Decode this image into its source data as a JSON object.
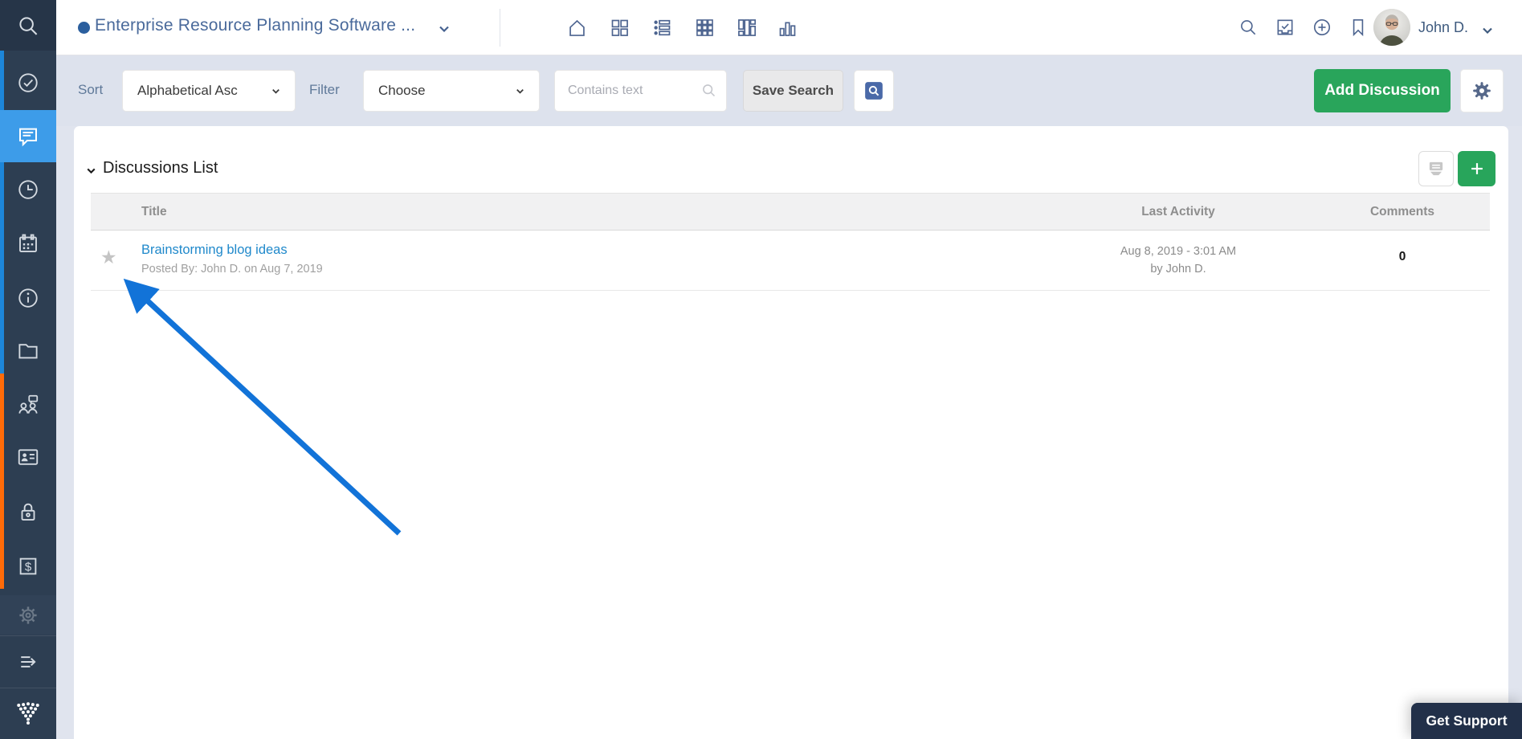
{
  "topbar": {
    "title": "Enterprise Resource Planning Software ...",
    "user_name": "John D.",
    "nav_icons": [
      "home-icon",
      "grid-2x2-icon",
      "list-view-icon",
      "grid-3x3-icon",
      "board-columns-icon",
      "bar-chart-icon"
    ],
    "right_icons": [
      "search-icon",
      "task-check-icon",
      "plus-circle-icon",
      "bookmark-icon",
      "bell-icon"
    ]
  },
  "sidebar": {
    "items": [
      "search",
      "tasks",
      "discussions",
      "time",
      "calendar",
      "info",
      "files",
      "workload",
      "contacts",
      "permissions",
      "expenses",
      "settings",
      "collapse",
      "logo"
    ],
    "active_item": "discussions"
  },
  "filter_bar": {
    "sort_label": "Sort",
    "sort_value": "Alphabetical Asc",
    "filter_label": "Filter",
    "filter_value": "Choose",
    "search_placeholder": "Contains text",
    "save_search_label": "Save Search",
    "add_discussion_label": "Add Discussion"
  },
  "discussions": {
    "heading": "Discussions List",
    "columns": {
      "title": "Title",
      "last_activity": "Last Activity",
      "comments": "Comments"
    },
    "rows": [
      {
        "title": "Brainstorming blog ideas",
        "posted_by": "Posted By: John D. on Aug 7, 2019",
        "last_activity_line1": "Aug 8, 2019 - 3:01 AM",
        "last_activity_line2": "by John D.",
        "comments": "0"
      }
    ]
  },
  "support_button": {
    "label": "Get Support"
  },
  "colors": {
    "sidebar_bg": "#2d3e52",
    "sidebar_active": "#3d9ce9",
    "stripe_blue": "#1d86d9",
    "stripe_orange": "#ff6b08",
    "accent_green": "#29a55b",
    "link_blue": "#2089cb",
    "arrow_blue": "#1273d8",
    "support_bg": "#223049",
    "filterbar_bg": "#dde2ed"
  }
}
